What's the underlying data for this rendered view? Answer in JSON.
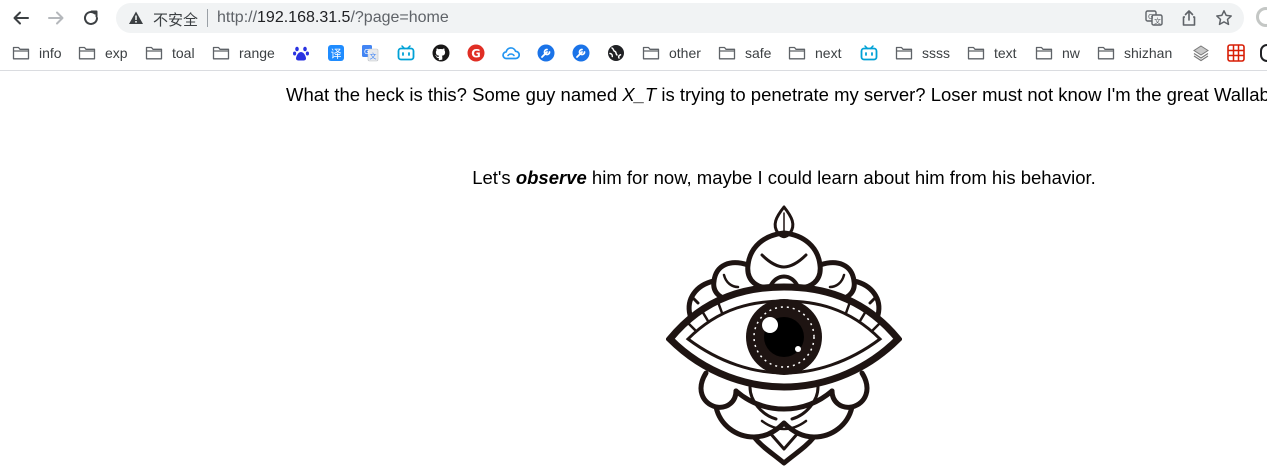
{
  "browser": {
    "insecure_label": "不安全",
    "url_prefix": "http://",
    "url_host": "192.168.31.5",
    "url_path": "/?page=home"
  },
  "bookmarks": {
    "folders": [
      "info",
      "exp",
      "toal",
      "range",
      "other",
      "safe",
      "next",
      "ssss",
      "text",
      "nw",
      "shizhan"
    ],
    "icons": [
      "baidu-paw-icon",
      "translate-yi-icon",
      "google-translate-icon",
      "bilibili-icon",
      "github-icon",
      "red-g-icon",
      "cloud-icon",
      "blue-tool-icon",
      "blue-tool-icon",
      "globe-icon",
      "bilibili-icon",
      "layers-icon",
      "red-grid-icon"
    ]
  },
  "page": {
    "line1_pre": "What the heck is this? Some guy named ",
    "line1_name": "X_T",
    "line1_post": " is trying to penetrate my server? Loser must not know I'm the great Wallaby!",
    "line2_pre": "Let's ",
    "line2_em": "observe",
    "line2_post": " him for now, maybe I could learn about him from his behavior.",
    "image_name": "ornate-eye"
  },
  "colors": {
    "ink": "#1e1412",
    "chrome_bg": "#f1f3f4",
    "text": "#202124"
  }
}
